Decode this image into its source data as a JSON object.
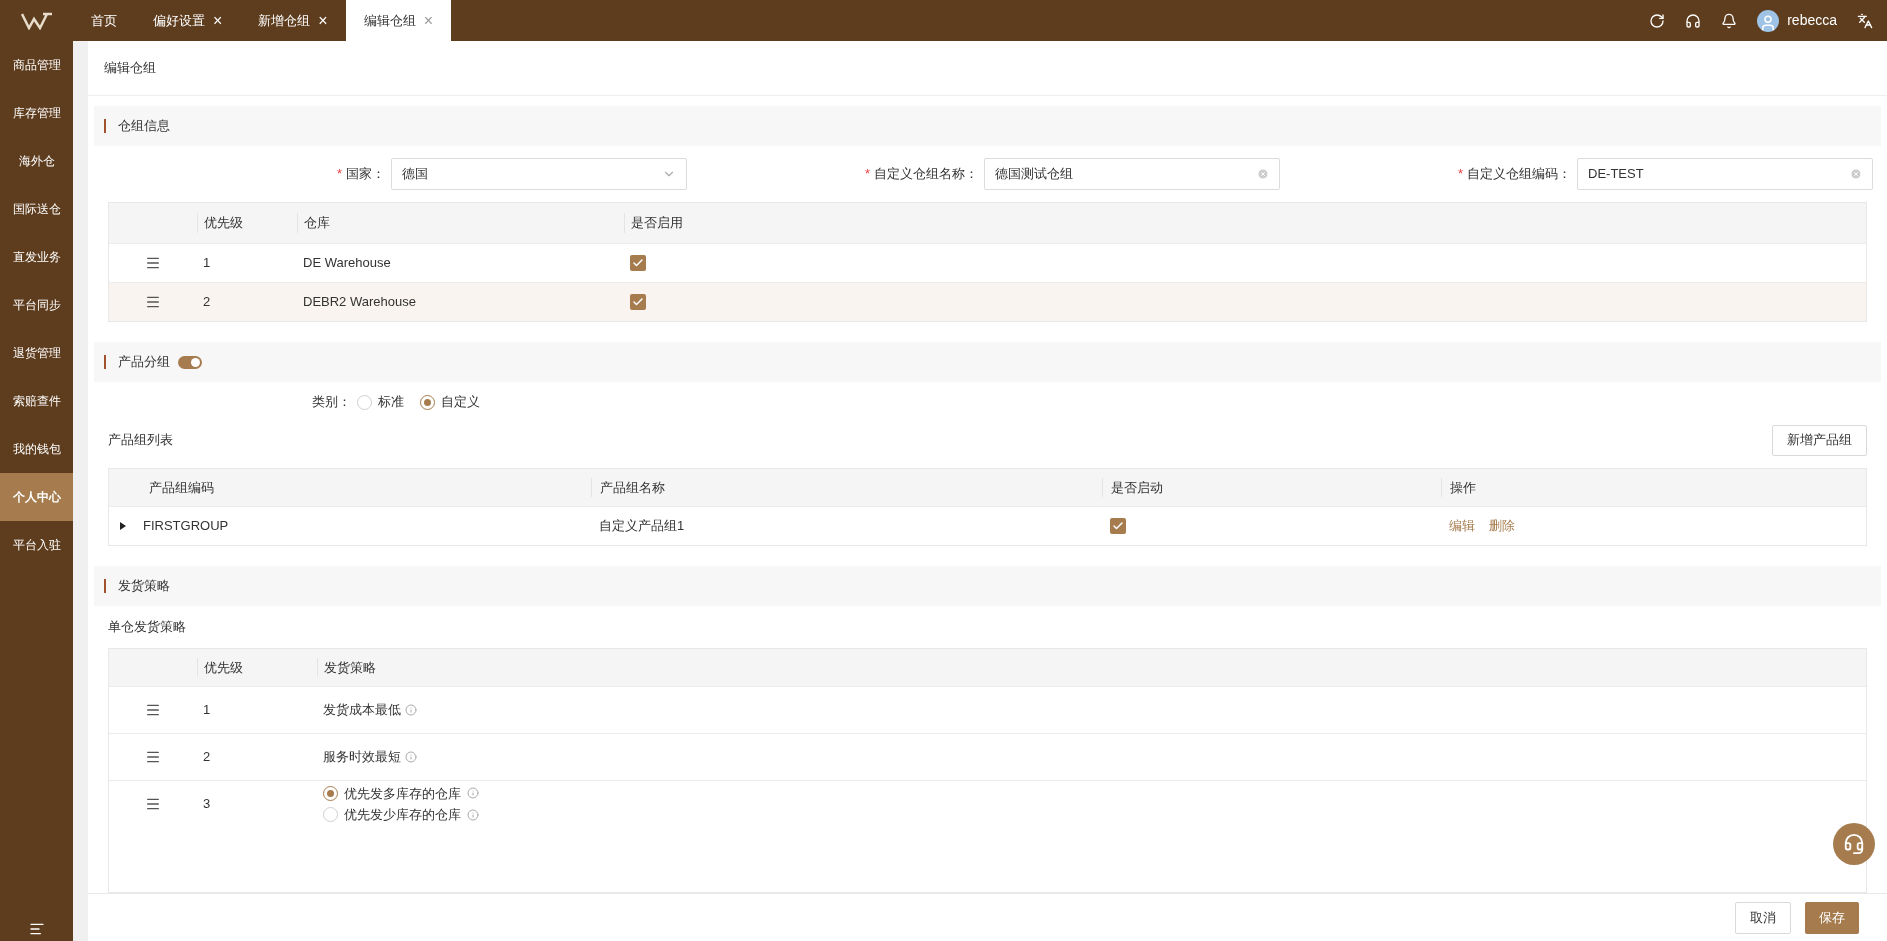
{
  "top_bar": {
    "tabs": [
      {
        "label": "首页",
        "closable": false,
        "selected": false
      },
      {
        "label": "偏好设置",
        "closable": true,
        "selected": false
      },
      {
        "label": "新增仓组",
        "closable": true,
        "selected": false
      },
      {
        "label": "编辑仓组",
        "closable": true,
        "selected": true
      }
    ],
    "close_glyph": "×",
    "user": "rebecca"
  },
  "sidebar": {
    "items": [
      {
        "label": "商品管理",
        "selected": false
      },
      {
        "label": "库存管理",
        "selected": false
      },
      {
        "label": "海外仓",
        "selected": false
      },
      {
        "label": "国际送仓",
        "selected": false
      },
      {
        "label": "直发业务",
        "selected": false
      },
      {
        "label": "平台同步",
        "selected": false
      },
      {
        "label": "退货管理",
        "selected": false
      },
      {
        "label": "索赔查件",
        "selected": false
      },
      {
        "label": "我的钱包",
        "selected": false
      },
      {
        "label": "个人中心",
        "selected": true
      },
      {
        "label": "平台入驻",
        "selected": false
      }
    ]
  },
  "page_title": "编辑仓组",
  "group_info": {
    "title": "仓组信息",
    "fields": [
      {
        "label": "国家：",
        "required": true,
        "kind": "select",
        "value": "德国"
      },
      {
        "label": "自定义仓组名称：",
        "required": true,
        "kind": "text",
        "value": "德国测试仓组"
      },
      {
        "label": "自定义仓组编码：",
        "required": true,
        "kind": "text",
        "value": "DE-TEST"
      }
    ],
    "required_mark": "*",
    "table": {
      "columns": [
        "优先级",
        "仓库",
        "是否启用"
      ],
      "rows": [
        {
          "priority": "1",
          "warehouse": "DE Warehouse",
          "enabled": true,
          "highlighted": false
        },
        {
          "priority": "2",
          "warehouse": "DEBR2 Warehouse",
          "enabled": true,
          "highlighted": true
        }
      ]
    }
  },
  "product_group": {
    "title": "产品分组",
    "on": true,
    "category_label": "类别：",
    "options": [
      {
        "label": "标准",
        "selected": false
      },
      {
        "label": "自定义",
        "selected": true
      }
    ],
    "list_title": "产品组列表",
    "add_button": "新增产品组",
    "table": {
      "columns": [
        "产品组编码",
        "产品组名称",
        "是否启动",
        "操作"
      ],
      "rows": [
        {
          "code": "FIRSTGROUP",
          "name": "自定义产品组1",
          "enabled": true,
          "expanded": false,
          "actions": [
            "编辑",
            "删除"
          ]
        }
      ]
    }
  },
  "shipping": {
    "title": "发货策略",
    "subtitle": "单仓发货策略",
    "table": {
      "columns": [
        "优先级",
        "发货策略"
      ],
      "rows": [
        {
          "priority": "1",
          "kind": "text",
          "strategy": "发货成本最低"
        },
        {
          "priority": "2",
          "kind": "text",
          "strategy": "服务时效最短"
        },
        {
          "priority": "3",
          "kind": "choice",
          "options": [
            {
              "label": "优先发多库存的仓库",
              "selected": true
            },
            {
              "label": "优先发少库存的仓库",
              "selected": false
            }
          ]
        }
      ]
    }
  },
  "footer": {
    "buttons": [
      {
        "label": "取消",
        "kind": "secondary"
      },
      {
        "label": "保存",
        "kind": "primary"
      }
    ]
  }
}
